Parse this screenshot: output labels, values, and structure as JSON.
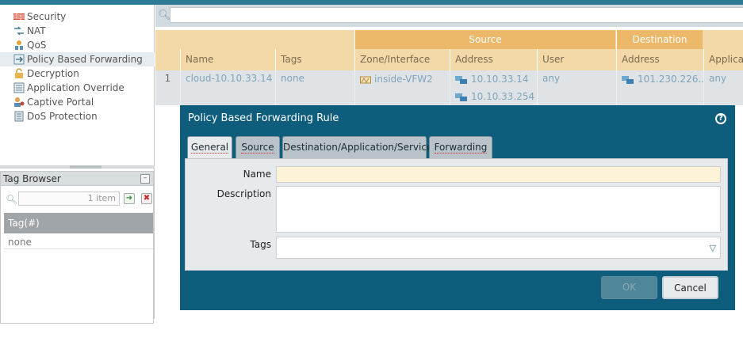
{
  "sidebar": {
    "items": [
      {
        "label": "Security",
        "icon": "firewall-icon",
        "selected": false
      },
      {
        "label": "NAT",
        "icon": "nat-icon",
        "selected": false
      },
      {
        "label": "QoS",
        "icon": "qos-icon",
        "selected": false
      },
      {
        "label": "Policy Based Forwarding",
        "icon": "pbf-icon",
        "selected": true
      },
      {
        "label": "Decryption",
        "icon": "lock-icon",
        "selected": false
      },
      {
        "label": "Application Override",
        "icon": "app-override-icon",
        "selected": false
      },
      {
        "label": "Captive Portal",
        "icon": "captive-portal-icon",
        "selected": false
      },
      {
        "label": "DoS Protection",
        "icon": "dos-protection-icon",
        "selected": false
      }
    ]
  },
  "tag_browser": {
    "title": "Tag Browser",
    "search_placeholder": "1 item",
    "column": "Tag(#)",
    "rows": [
      "none"
    ]
  },
  "rules_table": {
    "groups": {
      "source": "Source",
      "destination": "Destination"
    },
    "headers": {
      "name": "Name",
      "tags": "Tags",
      "zone": "Zone/Interface",
      "address": "Address",
      "user": "User",
      "dest_address": "Address",
      "application": "Applicati"
    },
    "rows": [
      {
        "index": "1",
        "name": "cloud-10.10.33.14",
        "tags": "none",
        "zone": "inside-VFW2",
        "address": [
          "10.10.33.14",
          "10.10.33.254"
        ],
        "user": "any",
        "dest_address": "101.230.226....",
        "application": "any"
      }
    ]
  },
  "dialog": {
    "title": "Policy Based Forwarding Rule",
    "tabs": [
      {
        "label": "General",
        "active": true
      },
      {
        "label": "Source",
        "active": false
      },
      {
        "label": "Destination/Application/Service",
        "active": false
      },
      {
        "label": "Forwarding",
        "active": false
      }
    ],
    "fields": {
      "name_label": "Name",
      "description_label": "Description",
      "tags_label": "Tags"
    },
    "buttons": {
      "ok": "OK",
      "cancel": "Cancel"
    }
  },
  "colors": {
    "accent": "#0f5d7d",
    "table_header": "#f3d9a8",
    "group_header": "#ecb86a",
    "link": "#7fa4bb"
  }
}
